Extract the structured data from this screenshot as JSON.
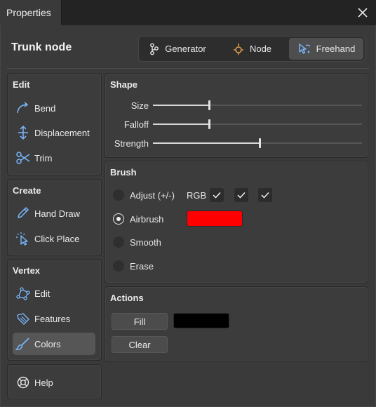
{
  "window": {
    "tab_title": "Properties"
  },
  "header": {
    "title": "Trunk node",
    "modes": [
      {
        "label": "Generator",
        "icon": "generator-icon",
        "active": false
      },
      {
        "label": "Node",
        "icon": "node-icon",
        "active": false
      },
      {
        "label": "Freehand",
        "icon": "freehand-icon",
        "active": true
      }
    ]
  },
  "sidebar": {
    "edit": {
      "title": "Edit",
      "items": [
        {
          "label": "Bend",
          "icon": "bend-icon"
        },
        {
          "label": "Displacement",
          "icon": "displacement-icon"
        },
        {
          "label": "Trim",
          "icon": "scissors-icon"
        }
      ]
    },
    "create": {
      "title": "Create",
      "items": [
        {
          "label": "Hand Draw",
          "icon": "pencil-icon"
        },
        {
          "label": "Click Place",
          "icon": "click-place-icon"
        }
      ]
    },
    "vertex": {
      "title": "Vertex",
      "items": [
        {
          "label": "Edit",
          "icon": "vertex-edit-icon"
        },
        {
          "label": "Features",
          "icon": "tag-icon"
        },
        {
          "label": "Colors",
          "icon": "brush-icon",
          "active": true
        }
      ]
    },
    "help": {
      "label": "Help",
      "icon": "lifebuoy-icon"
    }
  },
  "shape": {
    "title": "Shape",
    "sliders": [
      {
        "label": "Size",
        "value": 0.27
      },
      {
        "label": "Falloff",
        "value": 0.27
      },
      {
        "label": "Strength",
        "value": 0.51
      }
    ]
  },
  "brush": {
    "title": "Brush",
    "options": [
      {
        "label": "Adjust (+/-)",
        "selected": false
      },
      {
        "label": "Airbrush",
        "selected": true
      },
      {
        "label": "Smooth",
        "selected": false
      },
      {
        "label": "Erase",
        "selected": false
      }
    ],
    "channels_label": "RGB",
    "channels": [
      true,
      true,
      true
    ],
    "airbrush_color": "#ff0000"
  },
  "actions": {
    "title": "Actions",
    "fill_label": "Fill",
    "clear_label": "Clear",
    "fill_color": "#000000"
  }
}
